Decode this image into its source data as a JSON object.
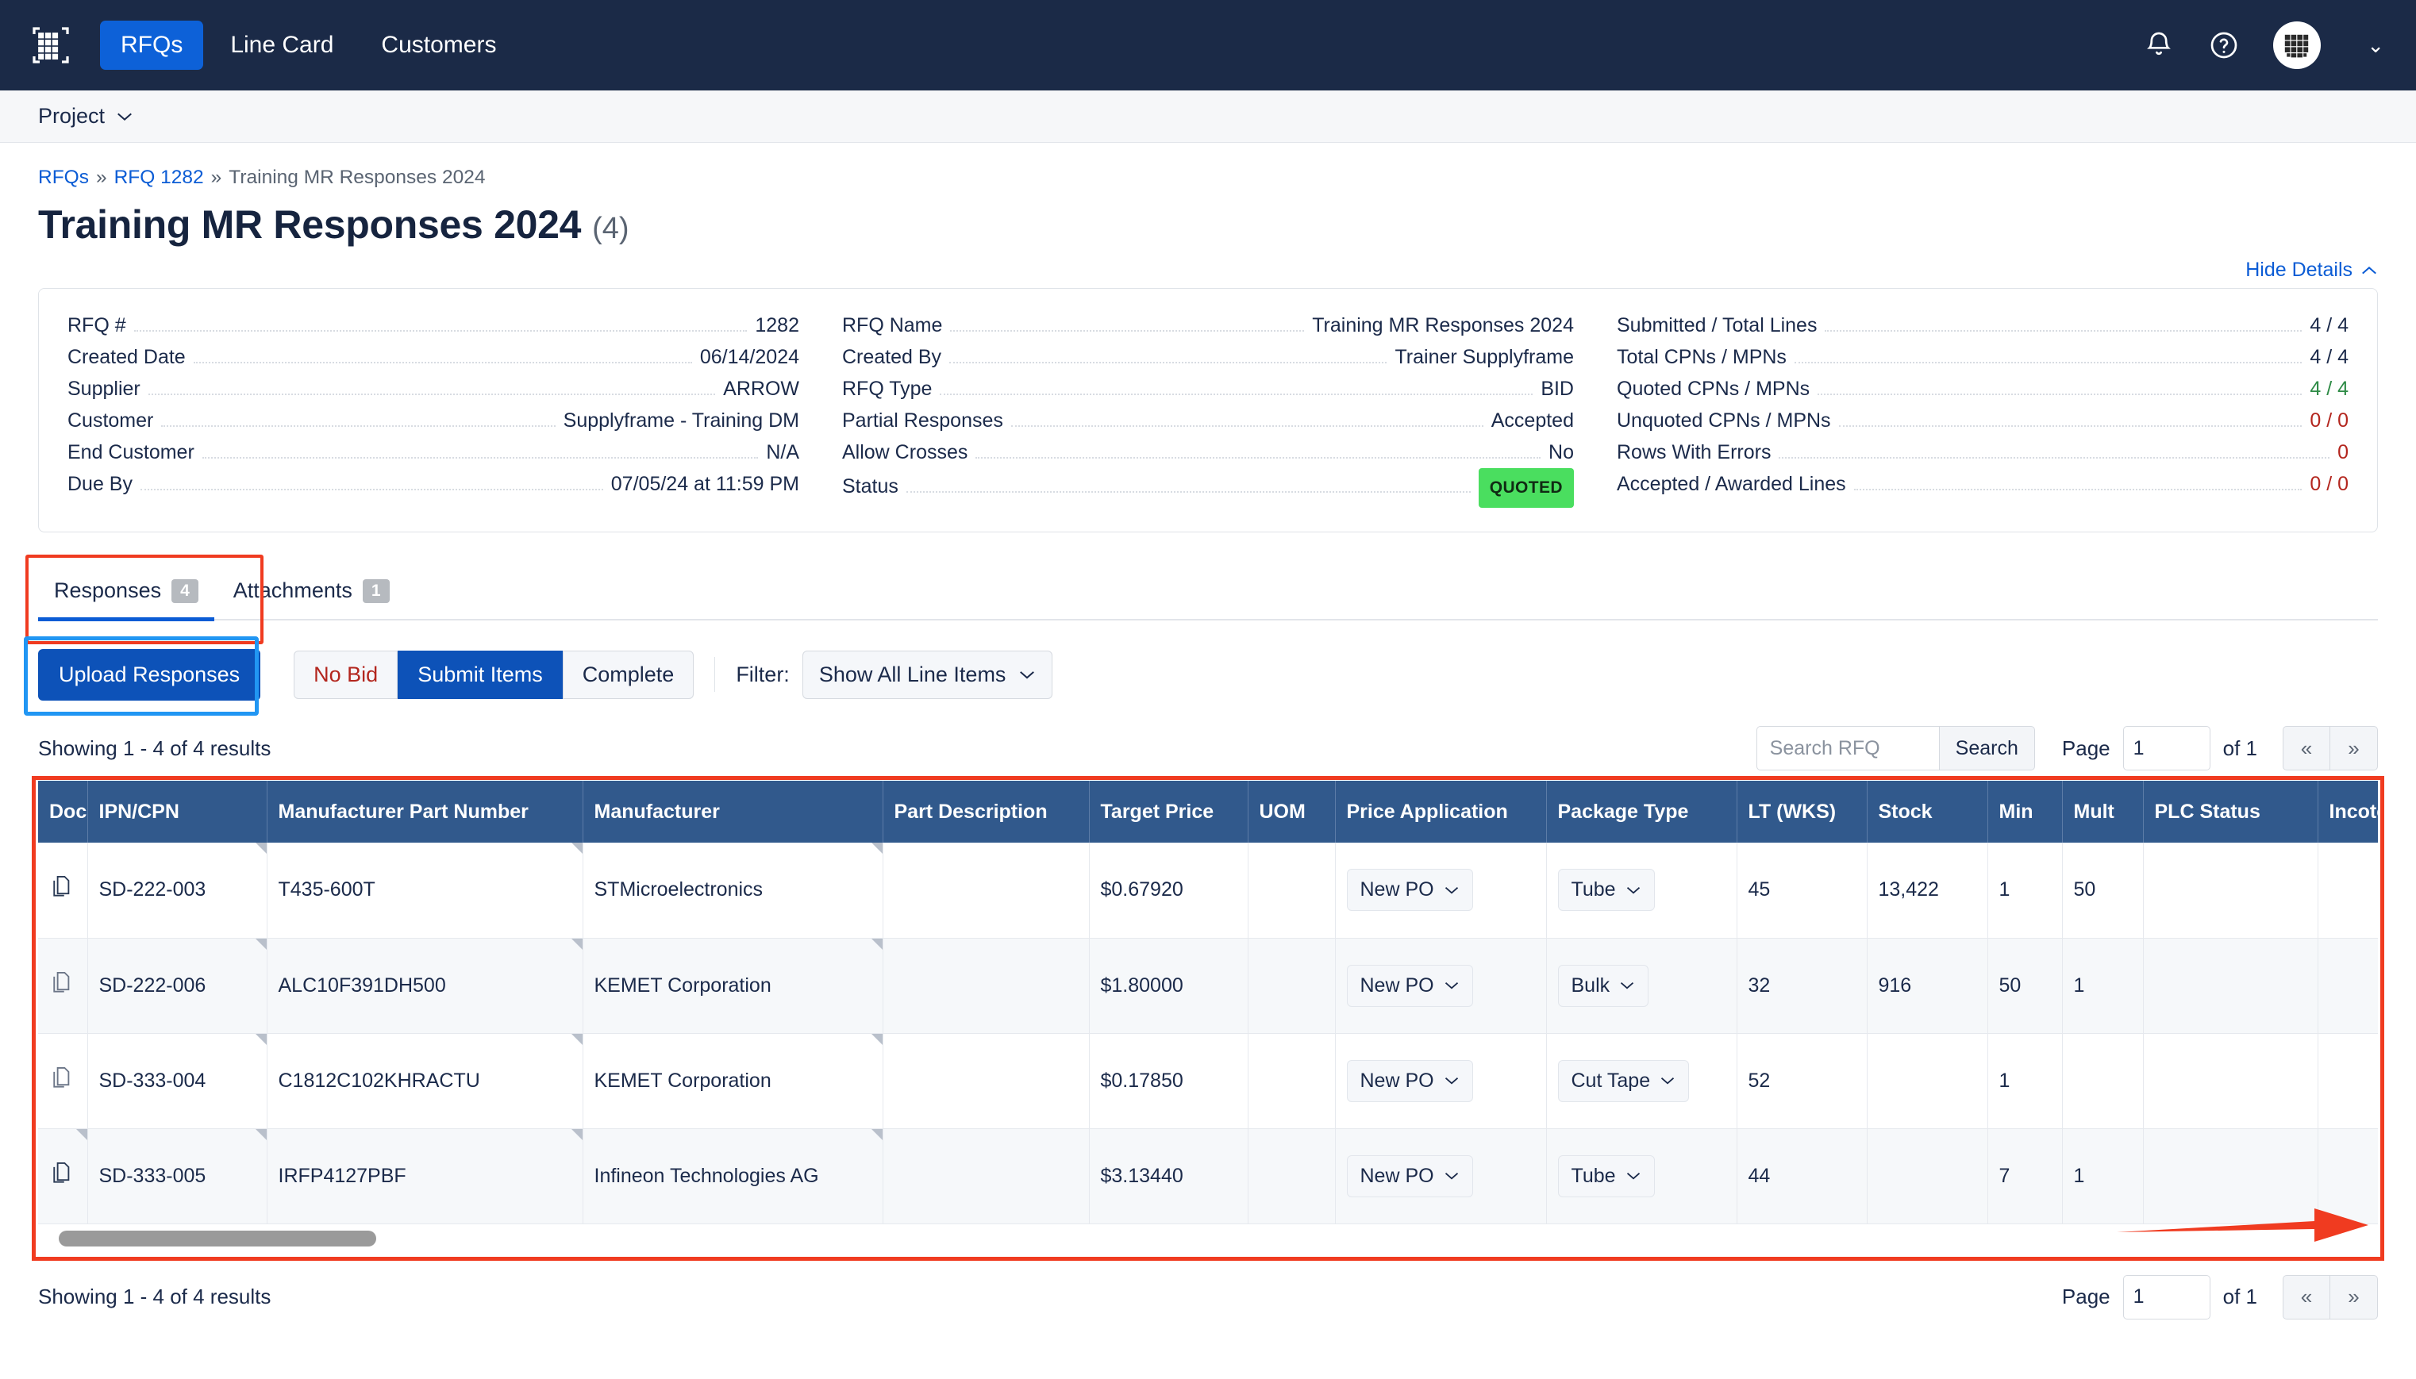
{
  "topnav": {
    "logo_icon": "grid-logo-icon",
    "links": [
      {
        "label": "RFQs",
        "active": true
      },
      {
        "label": "Line Card",
        "active": false
      },
      {
        "label": "Customers",
        "active": false
      }
    ],
    "bell_icon": "bell-icon",
    "help_icon": "question-circle-icon",
    "avatar_icon": "grid-avatar-icon",
    "avatar_caret": "⌄"
  },
  "projectbar": {
    "label": "Project",
    "caret": "⌄"
  },
  "breadcrumb": {
    "item1": "RFQs",
    "sep1": "»",
    "item2": "RFQ 1282",
    "sep2": "»",
    "item3": "Training MR Responses 2024"
  },
  "header": {
    "title": "Training MR Responses 2024",
    "count": "(4)",
    "hide_details": "Hide Details",
    "hide_details_caret": "⌃"
  },
  "details": {
    "col1": [
      {
        "label": "RFQ #",
        "value": "1282"
      },
      {
        "label": "Created Date",
        "value": "06/14/2024"
      },
      {
        "label": "Supplier",
        "value": "ARROW"
      },
      {
        "label": "Customer",
        "value": "Supplyframe - Training DM"
      },
      {
        "label": "End Customer",
        "value": "N/A"
      },
      {
        "label": "Due By",
        "value": "07/05/24 at 11:59 PM"
      }
    ],
    "col2": [
      {
        "label": "RFQ Name",
        "value": "Training MR Responses 2024"
      },
      {
        "label": "Created By",
        "value": "Trainer Supplyframe"
      },
      {
        "label": "RFQ Type",
        "value": "BID"
      },
      {
        "label": "Partial Responses",
        "value": "Accepted"
      },
      {
        "label": "Allow Crosses",
        "value": "No"
      },
      {
        "label": "Status",
        "value": "QUOTED",
        "badge": true
      }
    ],
    "col3": [
      {
        "label": "Submitted / Total Lines",
        "value": "4 / 4",
        "tone": ""
      },
      {
        "label": "Total CPNs / MPNs",
        "value": "4 / 4",
        "tone": ""
      },
      {
        "label": "Quoted CPNs / MPNs",
        "value": "4 / 4",
        "tone": "green"
      },
      {
        "label": "Unquoted CPNs / MPNs",
        "value": "0 / 0",
        "tone": "red"
      },
      {
        "label": "Rows With Errors",
        "value": "0",
        "tone": "red"
      },
      {
        "label": "Accepted / Awarded Lines",
        "value": "0 / 0",
        "tone": "red"
      }
    ]
  },
  "tabs": [
    {
      "label": "Responses",
      "badge": "4",
      "active": true
    },
    {
      "label": "Attachments",
      "badge": "1",
      "active": false
    }
  ],
  "toolbar": {
    "upload_label": "Upload Responses",
    "no_bid_label": "No Bid",
    "submit_label": "Submit Items",
    "complete_label": "Complete",
    "filter_label": "Filter:",
    "filter_value": "Show All Line Items",
    "filter_caret": "⌄"
  },
  "results": {
    "showing_text": "Showing 1 - 4 of 4 results",
    "search_placeholder": "Search RFQ",
    "search_value": "",
    "search_button": "Search",
    "page_label": "Page",
    "page_value": "1",
    "of_label": "of 1",
    "prev_glyph": "«",
    "next_glyph": "»"
  },
  "footer": {
    "showing_text": "Showing 1 - 4 of 4 results",
    "page_label": "Page",
    "page_value": "1",
    "of_label": "of 1",
    "prev_glyph": "«",
    "next_glyph": "»"
  },
  "table": {
    "columns": [
      "Doc",
      "IPN/CPN",
      "Manufacturer Part Number",
      "Manufacturer",
      "Part Description",
      "Target Price",
      "UOM",
      "Price Application",
      "Package Type",
      "LT (WKS)",
      "Stock",
      "Min",
      "Mult",
      "PLC Status",
      "Incoterms"
    ],
    "rows": [
      {
        "doc_icon": "copy-document-icon",
        "ipn_cpn": "SD-222-003",
        "mpn": "T435-600T",
        "manufacturer": "STMicroelectronics",
        "part_description": "",
        "target_price": "$0.67920",
        "uom": "",
        "price_application": "New PO",
        "package_type": "Tube",
        "lt_wks": "45",
        "stock": "13,422",
        "min": "1",
        "mult": "50",
        "plc_status": "",
        "incoterms": ""
      },
      {
        "doc_icon": "copy-document-icon",
        "ipn_cpn": "SD-222-006",
        "mpn": "ALC10F391DH500",
        "manufacturer": "KEMET Corporation",
        "part_description": "",
        "target_price": "$1.80000",
        "uom": "",
        "price_application": "New PO",
        "package_type": "Bulk",
        "lt_wks": "32",
        "stock": "916",
        "min": "50",
        "mult": "1",
        "plc_status": "",
        "incoterms": ""
      },
      {
        "doc_icon": "copy-document-icon",
        "ipn_cpn": "SD-333-004",
        "mpn": "C1812C102KHRACTU",
        "manufacturer": "KEMET Corporation",
        "part_description": "",
        "target_price": "$0.17850",
        "uom": "",
        "price_application": "New PO",
        "package_type": "Cut Tape",
        "lt_wks": "52",
        "stock": "",
        "min": "1",
        "mult": "",
        "plc_status": "",
        "incoterms": ""
      },
      {
        "doc_icon": "copy-document-icon",
        "ipn_cpn": "SD-333-005",
        "mpn": "IRFP4127PBF",
        "manufacturer": "Infineon Technologies AG",
        "part_description": "",
        "target_price": "$3.13440",
        "uom": "",
        "price_application": "New PO",
        "package_type": "Tube",
        "lt_wks": "44",
        "stock": "",
        "min": "7",
        "mult": "1",
        "plc_status": "",
        "incoterms": ""
      }
    ],
    "select_caret": "⌄"
  },
  "annotations": {
    "tab_highlight_color": "#f03b20",
    "upload_highlight_color": "#2196f3",
    "table_highlight_color": "#f03b20",
    "arrow_color": "#f03b20"
  }
}
